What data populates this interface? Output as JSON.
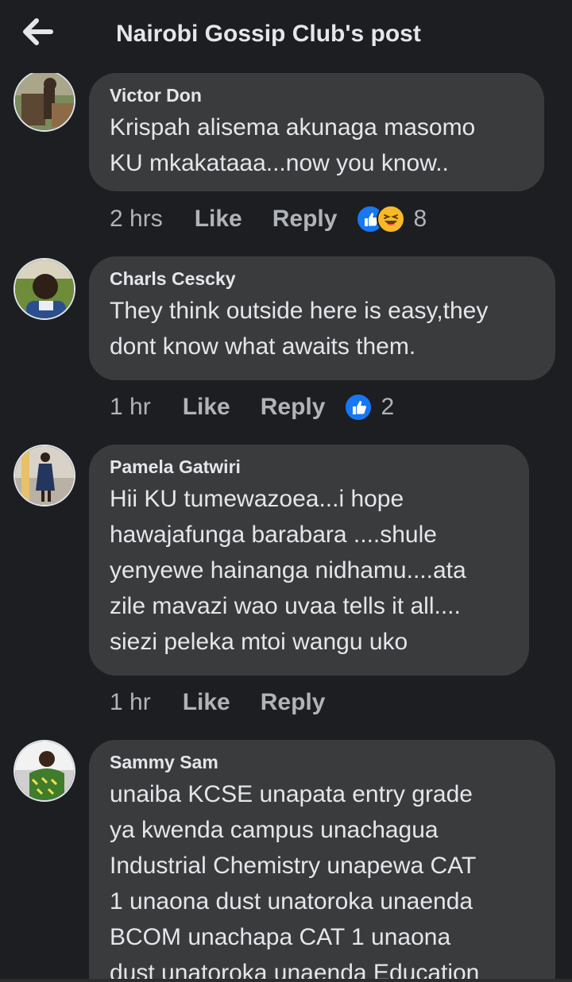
{
  "header": {
    "title": "Nairobi Gossip Club's post"
  },
  "comments": [
    {
      "author": "Victor Don",
      "lines": [
        "Krispah alisema akunaga masomo",
        "KU mkakataaa...now you know.."
      ],
      "time": "2 hrs",
      "like_label": "Like",
      "reply_label": "Reply",
      "reactions": [
        "like-icon",
        "haha-icon"
      ],
      "reaction_count": "8"
    },
    {
      "author": "Charls Cescky",
      "lines": [
        "They think outside here is easy,they",
        "dont know what awaits them."
      ],
      "time": "1 hr",
      "like_label": "Like",
      "reply_label": "Reply",
      "reactions": [
        "like-icon"
      ],
      "reaction_count": "2"
    },
    {
      "author": "Pamela Gatwiri",
      "lines": [
        "Hii KU tumewazoea...i hope",
        "hawajafunga barabara ....shule",
        "yenyewe hainanga nidhamu....ata",
        "zile mavazi wao uvaa tells it all....",
        "siezi peleka mtoi wangu uko"
      ],
      "time": "1 hr",
      "like_label": "Like",
      "reply_label": "Reply"
    },
    {
      "author": "Sammy Sam",
      "lines": [
        "unaiba KCSE unapata entry grade",
        "ya kwenda campus unachagua",
        "Industrial Chemistry unapewa CAT",
        "1 unaona dust unatoroka unaenda",
        "BCOM unachapa CAT 1 unaona",
        "dust unatoroka unaenda Education"
      ]
    }
  ],
  "colors": {
    "background": "#1c1e21",
    "bubble": "#3a3b3c",
    "text_primary": "#e4e6eb",
    "text_secondary": "#b0b3b8",
    "like_blue": "#1877f2",
    "haha_yellow": "#f7b928"
  }
}
